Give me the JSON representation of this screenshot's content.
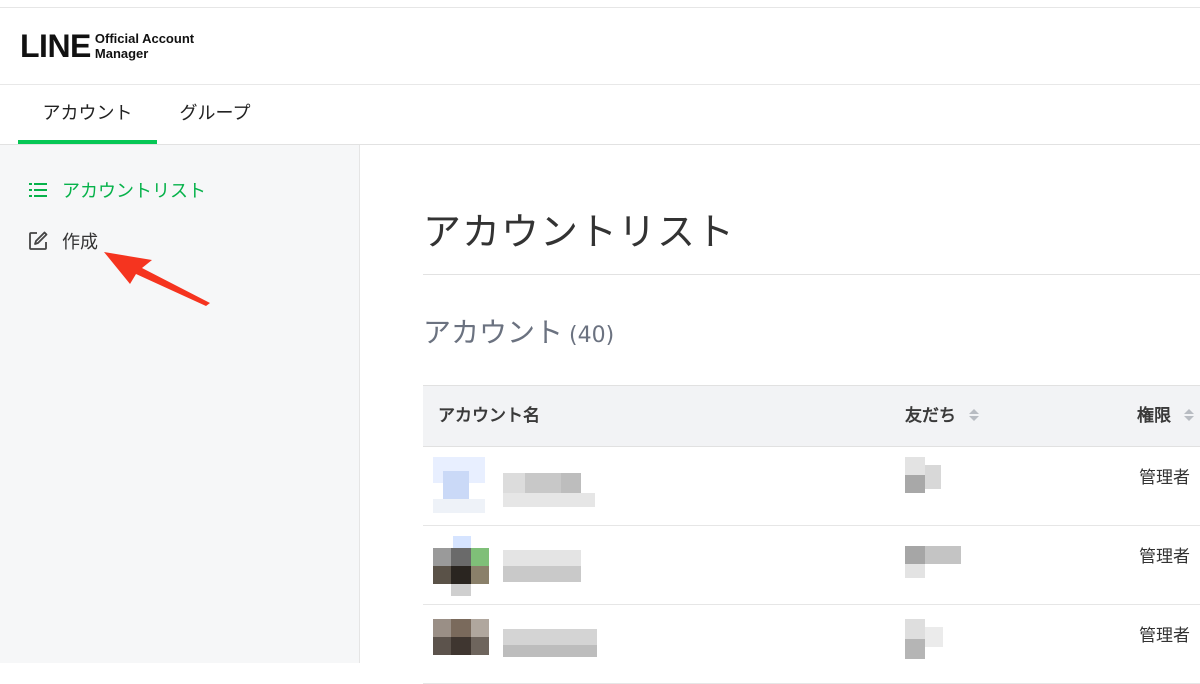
{
  "header": {
    "logo_main": "LINE",
    "logo_sub_line1": "Official Account",
    "logo_sub_line2": "Manager"
  },
  "tabs": [
    {
      "label": "アカウント",
      "active": true
    },
    {
      "label": "グループ",
      "active": false
    }
  ],
  "sidebar": {
    "items": [
      {
        "label": "アカウントリスト",
        "icon": "list-icon",
        "active": true
      },
      {
        "label": "作成",
        "icon": "edit-icon",
        "active": false
      }
    ]
  },
  "main": {
    "page_title": "アカウントリスト",
    "section_title": "アカウント",
    "section_count": "(40)",
    "table": {
      "columns": [
        "アカウント名",
        "友だち",
        "権限"
      ],
      "rows": [
        {
          "name": "",
          "friends": "",
          "role": "管理者"
        },
        {
          "name": "",
          "friends": "",
          "role": "管理者"
        },
        {
          "name": "",
          "friends": "",
          "role": "管理者"
        }
      ]
    }
  },
  "colors": {
    "accent": "#06c755",
    "sidebar_active": "#06b24a",
    "annotation_arrow": "#f5341f"
  }
}
